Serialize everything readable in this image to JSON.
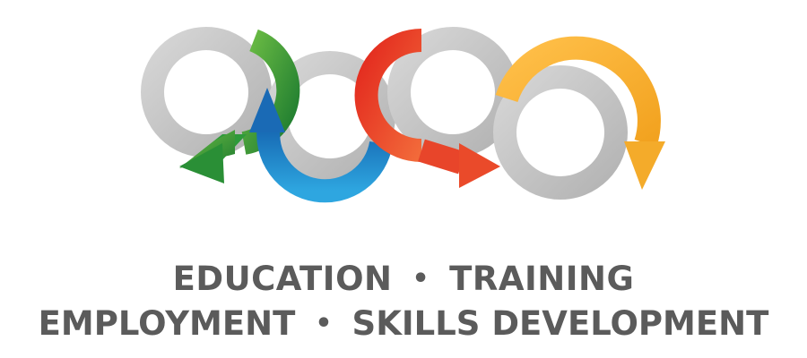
{
  "logo": {
    "colors": {
      "ring_grey": "#c9c9c9",
      "ring_grey_dark": "#a9a9a9",
      "green": "#2e9a3a",
      "blue": "#1f78c1",
      "red": "#d9261c",
      "yellow": "#f6b233",
      "text": "#5b5b5b"
    },
    "arrow_icons": [
      "green-arrow-icon",
      "blue-arrow-icon",
      "red-arrow-icon",
      "yellow-arrow-icon"
    ]
  },
  "tagline": {
    "line1": {
      "left": "EDUCATION",
      "separator": "•",
      "right": "TRAINING"
    },
    "line2": {
      "left": "EMPLOYMENT",
      "separator": "•",
      "right": "SKILLS DEVELOPMENT"
    }
  }
}
